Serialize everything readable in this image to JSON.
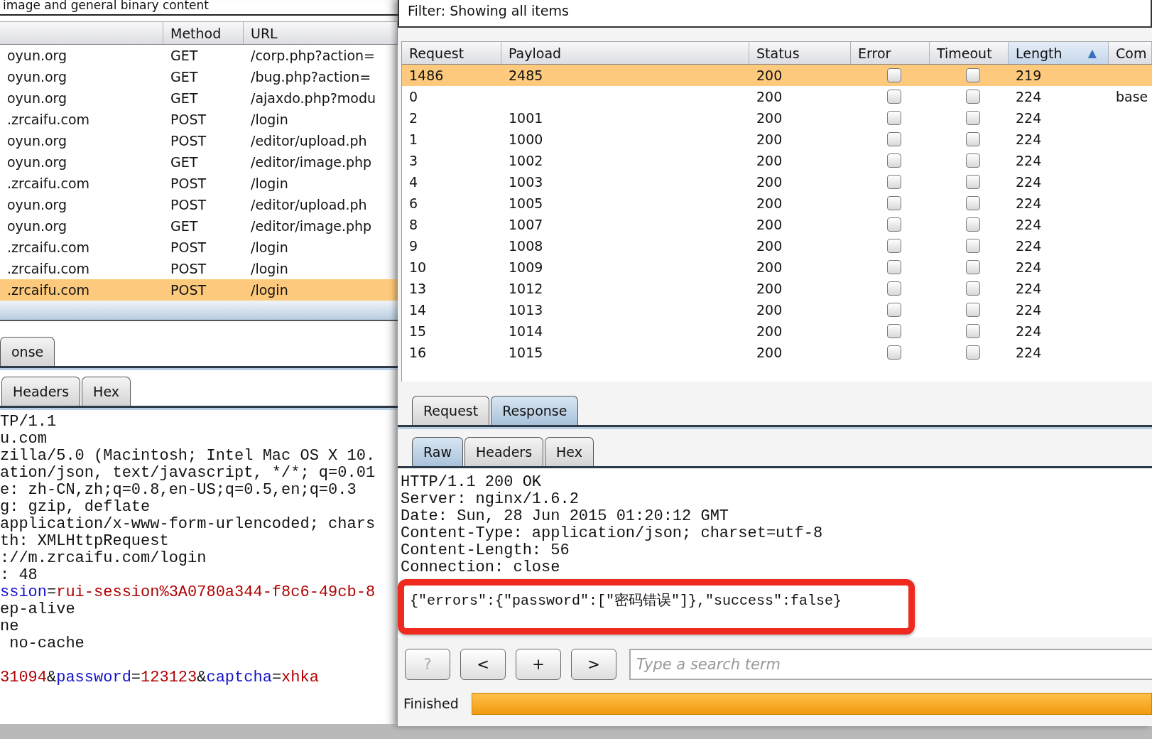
{
  "left_window": {
    "filter_text": "image and general binary content",
    "table": {
      "columns": [
        {
          "label": "Method"
        },
        {
          "label": "URL"
        }
      ],
      "rows": [
        {
          "host": "oyun.org",
          "method": "GET",
          "url": "/corp.php?action=",
          "selected": false
        },
        {
          "host": "oyun.org",
          "method": "GET",
          "url": "/bug.php?action=",
          "selected": false
        },
        {
          "host": "oyun.org",
          "method": "GET",
          "url": "/ajaxdo.php?modu",
          "selected": false
        },
        {
          "host": ".zrcaifu.com",
          "method": "POST",
          "url": "/login",
          "selected": false
        },
        {
          "host": "oyun.org",
          "method": "POST",
          "url": "/editor/upload.ph",
          "selected": false
        },
        {
          "host": "oyun.org",
          "method": "GET",
          "url": "/editor/image.php",
          "selected": false
        },
        {
          "host": ".zrcaifu.com",
          "method": "POST",
          "url": "/login",
          "selected": false
        },
        {
          "host": "oyun.org",
          "method": "POST",
          "url": "/editor/upload.ph",
          "selected": false
        },
        {
          "host": "oyun.org",
          "method": "GET",
          "url": "/editor/image.php",
          "selected": false
        },
        {
          "host": ".zrcaifu.com",
          "method": "POST",
          "url": "/login",
          "selected": false
        },
        {
          "host": ".zrcaifu.com",
          "method": "POST",
          "url": "/login",
          "selected": false
        },
        {
          "host": ".zrcaifu.com",
          "method": "POST",
          "url": "/login",
          "selected": true
        }
      ]
    },
    "message_tabs": [
      {
        "label": "onse",
        "selected": false
      }
    ],
    "view_tabs": [
      {
        "label": "Headers",
        "selected": false
      },
      {
        "label": "Hex",
        "selected": false
      }
    ],
    "request_lines": [
      [
        {
          "kind": "plain",
          "text": "TP/1.1"
        }
      ],
      [
        {
          "kind": "plain",
          "text": "u.com"
        }
      ],
      [
        {
          "kind": "plain",
          "text": "zilla/5.0 (Macintosh; Intel Mac OS X 10."
        }
      ],
      [
        {
          "kind": "plain",
          "text": "ation/json, text/javascript, */*; q=0.01"
        }
      ],
      [
        {
          "kind": "plain",
          "text": "e: zh-CN,zh;q=0.8,en-US;q=0.5,en;q=0.3"
        }
      ],
      [
        {
          "kind": "plain",
          "text": "g: gzip, deflate"
        }
      ],
      [
        {
          "kind": "plain",
          "text": "application/x-www-form-urlencoded; chars"
        }
      ],
      [
        {
          "kind": "plain",
          "text": "th: XMLHttpRequest"
        }
      ],
      [
        {
          "kind": "plain",
          "text": "://m.zrcaifu.com/login"
        }
      ],
      [
        {
          "kind": "plain",
          "text": ": 48"
        }
      ],
      [
        {
          "kind": "key",
          "text": "ssion"
        },
        {
          "kind": "plain",
          "text": "="
        },
        {
          "kind": "value",
          "text": "rui-session%3A0780a344-f8c6-49cb-8"
        }
      ],
      [
        {
          "kind": "plain",
          "text": "ep-alive"
        }
      ],
      [
        {
          "kind": "plain",
          "text": "ne"
        }
      ],
      [
        {
          "kind": "plain",
          "text": " no-cache"
        }
      ]
    ],
    "body": [
      {
        "kind": "value",
        "text": "31094"
      },
      {
        "kind": "plain",
        "text": "&"
      },
      {
        "kind": "key",
        "text": "password"
      },
      {
        "kind": "plain",
        "text": "="
      },
      {
        "kind": "value",
        "text": "123123"
      },
      {
        "kind": "plain",
        "text": "&"
      },
      {
        "kind": "key",
        "text": "captcha"
      },
      {
        "kind": "plain",
        "text": "="
      },
      {
        "kind": "value",
        "text": "xhka"
      }
    ]
  },
  "right_window": {
    "filter_text": "Filter: Showing all items",
    "table": {
      "columns": [
        {
          "label": "Request",
          "sorted": false
        },
        {
          "label": "Payload",
          "sorted": false
        },
        {
          "label": "Status",
          "sorted": false
        },
        {
          "label": "Error",
          "sorted": false
        },
        {
          "label": "Timeout",
          "sorted": false
        },
        {
          "label": "Length",
          "sorted": true,
          "sort_glyph": "▲"
        },
        {
          "label": "Com",
          "sorted": false
        }
      ],
      "rows": [
        {
          "request": "1486",
          "payload": "2485",
          "status": "200",
          "error": false,
          "timeout": false,
          "length": "219",
          "selected": true
        },
        {
          "request": "0",
          "status": "200",
          "error": false,
          "timeout": false,
          "length": "224",
          "comment": "base",
          "selected": false
        },
        {
          "request": "2",
          "payload": "1001",
          "status": "200",
          "error": false,
          "timeout": false,
          "length": "224",
          "selected": false
        },
        {
          "request": "1",
          "payload": "1000",
          "status": "200",
          "error": false,
          "timeout": false,
          "length": "224",
          "selected": false
        },
        {
          "request": "3",
          "payload": "1002",
          "status": "200",
          "error": false,
          "timeout": false,
          "length": "224",
          "selected": false
        },
        {
          "request": "4",
          "payload": "1003",
          "status": "200",
          "error": false,
          "timeout": false,
          "length": "224",
          "selected": false
        },
        {
          "request": "6",
          "payload": "1005",
          "status": "200",
          "error": false,
          "timeout": false,
          "length": "224",
          "selected": false
        },
        {
          "request": "8",
          "payload": "1007",
          "status": "200",
          "error": false,
          "timeout": false,
          "length": "224",
          "selected": false
        },
        {
          "request": "9",
          "payload": "1008",
          "status": "200",
          "error": false,
          "timeout": false,
          "length": "224",
          "selected": false
        },
        {
          "request": "10",
          "payload": "1009",
          "status": "200",
          "error": false,
          "timeout": false,
          "length": "224",
          "selected": false
        },
        {
          "request": "13",
          "payload": "1012",
          "status": "200",
          "error": false,
          "timeout": false,
          "length": "224",
          "selected": false
        },
        {
          "request": "14",
          "payload": "1013",
          "status": "200",
          "error": false,
          "timeout": false,
          "length": "224",
          "selected": false
        },
        {
          "request": "15",
          "payload": "1014",
          "status": "200",
          "error": false,
          "timeout": false,
          "length": "224",
          "selected": false
        },
        {
          "request": "16",
          "payload": "1015",
          "status": "200",
          "error": false,
          "timeout": false,
          "length": "224",
          "selected": false
        }
      ]
    },
    "message_tabs": [
      {
        "label": "Request",
        "selected": false
      },
      {
        "label": "Response",
        "selected": true
      }
    ],
    "view_tabs": [
      {
        "label": "Raw",
        "selected": true
      },
      {
        "label": "Headers",
        "selected": false
      },
      {
        "label": "Hex",
        "selected": false
      }
    ],
    "response_lines": [
      "HTTP/1.1 200 OK",
      "Server: nginx/1.6.2",
      "Date: Sun, 28 Jun 2015 01:20:12 GMT",
      "Content-Type: application/json; charset=utf-8",
      "Content-Length: 56",
      "Connection: close"
    ],
    "highlighted_body": "{\"errors\":{\"password\":[\"密码错误\"]},\"success\":false}",
    "buttons": [
      {
        "label": "?",
        "disabled": true
      },
      {
        "label": "<",
        "disabled": false
      },
      {
        "label": "+",
        "disabled": false
      },
      {
        "label": ">",
        "disabled": false
      }
    ],
    "search": {
      "placeholder": "Type a search term"
    },
    "status": {
      "text": "Finished",
      "level": 1
    }
  }
}
